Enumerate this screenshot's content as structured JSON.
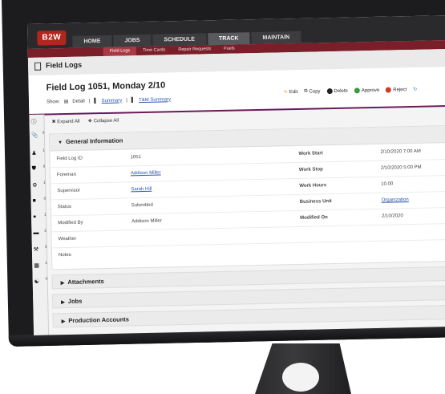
{
  "app": {
    "logo_text": "B2W",
    "main_tabs": [
      "HOME",
      "JOBS",
      "SCHEDULE",
      "TRACK",
      "MAINTAIN"
    ],
    "active_main_tab": "TRACK",
    "sub_tabs": [
      "Field Logs",
      "Time Cards",
      "Repair Requests",
      "Fuels"
    ],
    "active_sub_tab": "Field Logs",
    "brand_color": "#b3261e",
    "subnav_color": "#7a1f2a"
  },
  "page": {
    "title": "Field Logs",
    "record_title": "Field Log 1051, Monday 2/10",
    "show_label": "Show:",
    "show_links": [
      "Detail",
      "Summary",
      "T&M Summary"
    ]
  },
  "actions": {
    "edit": "Edit",
    "copy": "Copy",
    "delete": "Delete",
    "approve": "Approve",
    "reject": "Reject"
  },
  "rail": [
    {
      "icon": "info-icon",
      "badge": ""
    },
    {
      "icon": "paperclip-icon",
      "badge": "0"
    },
    {
      "icon": "worker-icon",
      "badge": "1"
    },
    {
      "icon": "truck-icon",
      "badge": "0"
    },
    {
      "icon": "equipment-icon",
      "badge": "1"
    },
    {
      "icon": "machine-icon",
      "badge": "0"
    },
    {
      "icon": "person-icon",
      "badge": "1"
    },
    {
      "icon": "trailer-icon",
      "badge": "2"
    },
    {
      "icon": "tools-icon",
      "badge": "3"
    },
    {
      "icon": "material-icon",
      "badge": "1"
    },
    {
      "icon": "crew-icon",
      "badge": "0"
    }
  ],
  "controls": {
    "expand_all": "Expand All",
    "collapse_all": "Collapse All"
  },
  "general": {
    "heading": "General Information",
    "rows": [
      {
        "label": "Field Log ID",
        "value": "1051",
        "label2": "Work Start",
        "value2": "2/10/2020 7:00 AM"
      },
      {
        "label": "Foreman",
        "value": "Addison Miller",
        "label2": "Work Stop",
        "value2": "2/10/2020 5:00 PM"
      },
      {
        "label": "Supervisor",
        "value": "Sarah Hill",
        "label2": "Work Hours",
        "value2": "10.00"
      },
      {
        "label": "Status",
        "value": "Submitted",
        "label2": "Business Unit",
        "value2": "Organization"
      },
      {
        "label": "Modified By",
        "value": "Addison Miller",
        "label2": "Modified On",
        "value2": "2/10/2020"
      },
      {
        "label": "Weather",
        "value": "",
        "label2": "",
        "value2": ""
      },
      {
        "label": "Notes",
        "value": "",
        "label2": "",
        "value2": ""
      }
    ]
  },
  "sections": [
    "Attachments",
    "Jobs",
    "Production Accounts"
  ]
}
